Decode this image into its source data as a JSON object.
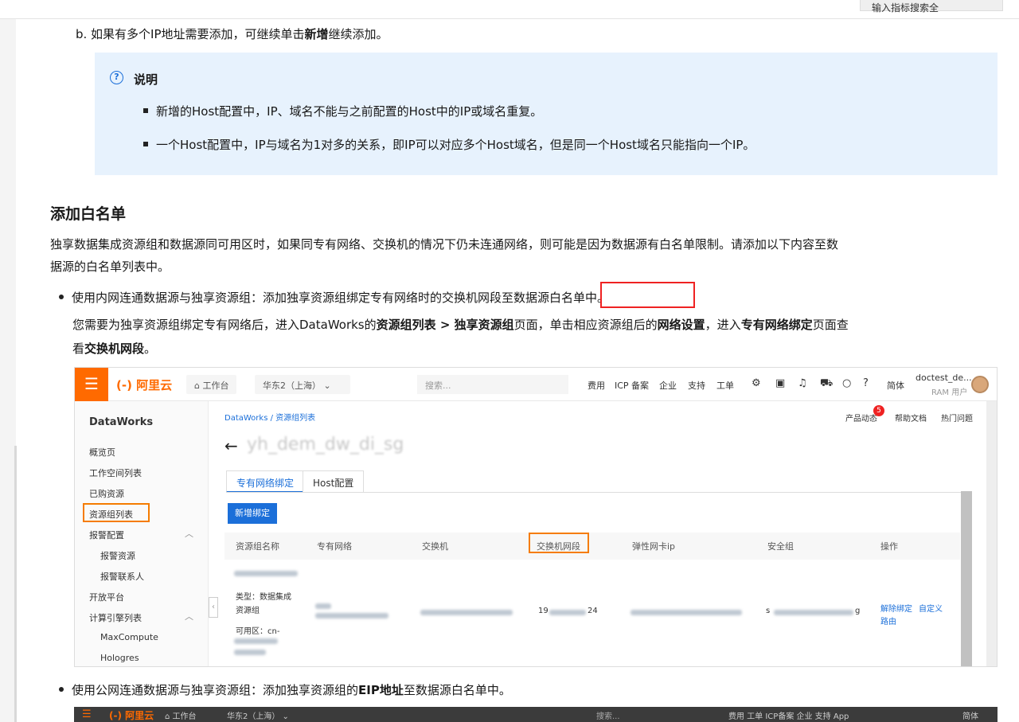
{
  "top_button": {
    "label": "输入指标搜索全"
  },
  "step_b": {
    "prefix": "b. 如果有多个IP地址需要添加，可继续单击",
    "bold": "新增",
    "suffix": "继续添加。"
  },
  "note": {
    "title": "说明",
    "items": [
      "新增的Host配置中，IP、域名不能与之前配置的Host中的IP或域名重复。",
      "一个Host配置中，IP与域名为1对多的关系，即IP可以对应多个Host域名，但是同一个Host域名只能指向一个IP。"
    ]
  },
  "section": {
    "title": "添加白名单",
    "para_line1": "独享数据集成资源组和数据源同可用区时，如果同专有网络、交换机的情况下仍未连通网络，则可能是因为数据源有白名单限制。请添加以下内容至数",
    "para_line2": "据源的白名单列表中。"
  },
  "bullet1": {
    "text": "使用内网连通数据源与独享资源组：添加独享资源组绑定专有网络时的交换机网段至数据源白名单中。",
    "sub_a": "您需要为独享资源组绑定专有网络后，进入DataWorks的",
    "sub_b": "资源组列表 > 独享资源组",
    "sub_c": "页面，单击相应资源组后的",
    "sub_d": "网络设置",
    "sub_e": "，进入",
    "sub_f": "专有网络绑定",
    "sub_g": "页面查",
    "sub_h": "看",
    "sub_i": "交换机网段",
    "sub_j": "。"
  },
  "console": {
    "logo": "(-) 阿里云",
    "workbench": "⌂ 工作台",
    "region": "华东2（上海） ⌄",
    "search_placeholder": "搜索...",
    "nav": [
      "费用",
      "ICP 备案",
      "企业",
      "支持",
      "工单"
    ],
    "lang": "简体",
    "user": "doctest_de...",
    "user_role": "RAM 用户",
    "sidebar": {
      "title": "DataWorks",
      "items": [
        "概览页",
        "工作空间列表",
        "已购资源",
        "资源组列表",
        "报警配置",
        "报警资源",
        "报警联系人",
        "开放平台",
        "计算引擎列表",
        "MaxCompute",
        "Hologres"
      ]
    },
    "breadcrumb": "DataWorks  /  资源组列表",
    "top_links": [
      "产品动态",
      "帮助文档",
      "热门问题"
    ],
    "badge": "5",
    "group_title": "yh_dem_dw_di_sg",
    "tabs": [
      "专有网络绑定",
      "Host配置"
    ],
    "add_button": "新增绑定",
    "columns": [
      "资源组名称",
      "专有网络",
      "交换机",
      "交换机网段",
      "弹性网卡ip",
      "安全组",
      "操作"
    ],
    "row": {
      "type": "类型：数据集成",
      "type2": "资源组",
      "zone": "可用区：cn-",
      "cidr_a": "19",
      "cidr_b": "24",
      "sg_a": "s",
      "sg_b": "g",
      "actions": [
        "解除绑定",
        "自定义"
      ],
      "actions2": "路由"
    }
  },
  "bullet2": {
    "a": "使用公网连通数据源与独享资源组：添加独享资源组的",
    "b": "EIP地址",
    "c": "至数据源白名单中。"
  },
  "console2": {
    "logo": "(-) 阿里云",
    "workbench": "⌂ 工作台",
    "region": "华东2（上海） ⌄",
    "search": "搜索...",
    "nav": "费用  工单  ICP备案  企业  支持  App",
    "lang": "简体"
  }
}
